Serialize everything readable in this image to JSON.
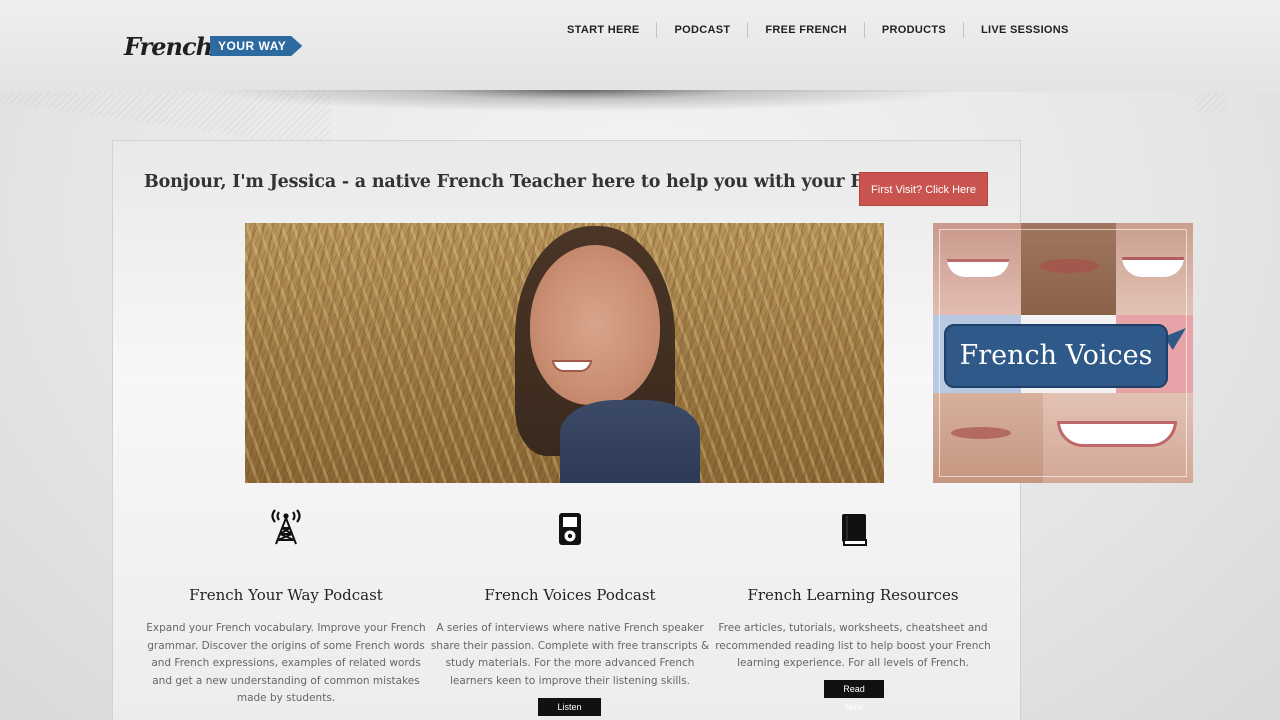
{
  "header": {
    "logo": {
      "script": "French",
      "ribbon": "YOUR WAY"
    },
    "nav": [
      "START HERE",
      "PODCAST",
      "FREE FRENCH",
      "PRODUCTS",
      "LIVE SESSIONS"
    ]
  },
  "intro": {
    "greeting": "Bonjour, I'm Jessica - a native French Teacher here to help you with your French.",
    "cta_label": "First Visit? Click Here",
    "cta_color": "#c9534f"
  },
  "side_ad": {
    "title": "French Voices",
    "bubble_color": "#2f5988"
  },
  "features": [
    {
      "icon": "radio-tower-icon",
      "title": "French Your Way Podcast",
      "description": "Expand your French vocabulary. Improve your French grammar. Discover the origins of some French words and French expressions, examples of related words and get a new understanding of common mistakes made by students."
    },
    {
      "icon": "ipod-icon",
      "title": "French Voices Podcast",
      "description": "A series of interviews where native French speaker share their passion. Complete with free transcripts & study materials. For the more advanced French learners keen to improve their listening skills.",
      "button": "Listen Now"
    },
    {
      "icon": "book-icon",
      "title": "French Learning Resources",
      "description": "Free articles, tutorials, worksheets, cheatsheet and recommended reading list to help boost your French learning experience. For all levels of French.",
      "button": "Read Now"
    }
  ]
}
